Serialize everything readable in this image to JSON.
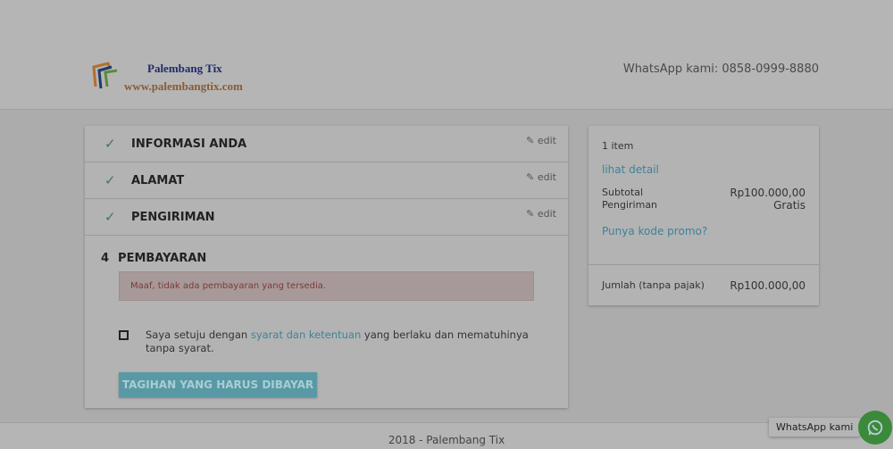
{
  "header": {
    "logo_title": "Palembang Tix",
    "logo_url": "www.palembangtix.com",
    "whatsapp": "WhatsApp kami: 0858-0999-8880"
  },
  "steps": [
    {
      "title": "INFORMASI ANDA",
      "edit": "edit"
    },
    {
      "title": "ALAMAT",
      "edit": "edit"
    },
    {
      "title": "PENGIRIMAN",
      "edit": "edit"
    }
  ],
  "payment": {
    "number": "4",
    "title": "PEMBAYARAN",
    "alert": "Maaf, tidak ada pembayaran yang tersedia.",
    "agree_before": "Saya setuju dengan ",
    "agree_link": "syarat dan ketentuan",
    "agree_after": " yang berlaku dan mematuhinya tanpa syarat.",
    "button": "TAGIHAN YANG HARUS DIBAYAR"
  },
  "summary": {
    "items": "1 item",
    "detail": "lihat detail",
    "subtotal_label": "Subtotal",
    "subtotal": "Rp100.000,00",
    "shipping_label": "Pengiriman",
    "shipping": "Gratis",
    "promo": "Punya kode promo?",
    "total_label": "Jumlah (tanpa pajak)",
    "total": "Rp100.000,00"
  },
  "footer": {
    "text": "2018 - Palembang Tix"
  },
  "whatsapp_widget": {
    "label": "WhatsApp kami"
  }
}
